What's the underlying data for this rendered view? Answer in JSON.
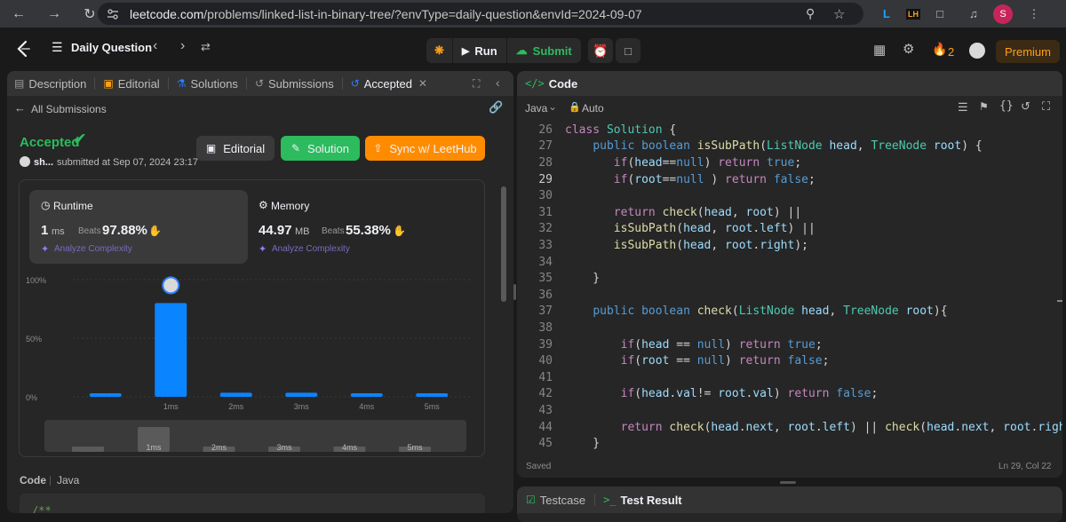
{
  "browser": {
    "url_host": "leetcode.com",
    "url_path": "/problems/linked-list-in-binary-tree/?envType=daily-question&envId=2024-09-07",
    "profile_initial": "S",
    "ext_lh": "LH"
  },
  "header": {
    "problem_list_title": "Daily Question",
    "run_label": "Run",
    "submit_label": "Submit",
    "streak_count": "2",
    "premium_label": "Premium"
  },
  "left_tabs": [
    {
      "label": "Description"
    },
    {
      "label": "Editorial"
    },
    {
      "label": "Solutions"
    },
    {
      "label": "Submissions"
    },
    {
      "label": "Accepted"
    }
  ],
  "submission": {
    "back_label": "All Submissions",
    "status": "Accepted",
    "user": "sh...",
    "submitted_text": "submitted at Sep 07, 2024 23:17",
    "editorial_btn": "Editorial",
    "solution_btn": "Solution",
    "sync_btn": "Sync w/ LeetHub"
  },
  "runtime": {
    "title": "Runtime",
    "value": "1",
    "unit": "ms",
    "beats_label": "Beats",
    "beats": "97.88%",
    "analyze": "Analyze Complexity"
  },
  "memory": {
    "title": "Memory",
    "value": "44.97",
    "unit": "MB",
    "beats_label": "Beats",
    "beats": "55.38%",
    "analyze": "Analyze Complexity"
  },
  "chart_data": {
    "type": "bar",
    "y_tick_labels": [
      "100%",
      "50%",
      "0%"
    ],
    "categories": [
      "",
      "1ms",
      "2ms",
      "3ms",
      "4ms",
      "5ms"
    ],
    "values": [
      3,
      80,
      3.5,
      3.5,
      3,
      3
    ],
    "ylim": [
      0,
      100
    ],
    "highlight_index": 1,
    "bar_color": "#0a84ff",
    "mini_ticks": [
      "1ms",
      "2ms",
      "3ms",
      "4ms",
      "5ms"
    ]
  },
  "bottom_code_header": {
    "code": "Code",
    "lang": "Java",
    "snippet": "/**"
  },
  "editor": {
    "title": "Code",
    "language": "Java",
    "mode": "Auto",
    "status_saved": "Saved",
    "cursor_pos": "Ln 29, Col 22"
  },
  "code_lines": [
    {
      "n": "26",
      "text": "class Solution {"
    },
    {
      "n": "27",
      "text": "    public boolean isSubPath(ListNode head, TreeNode root) {"
    },
    {
      "n": "28",
      "text": "       if(head==null) return true;"
    },
    {
      "n": "29",
      "text": "       if(root==null ) return false;"
    },
    {
      "n": "30",
      "text": ""
    },
    {
      "n": "31",
      "text": "       return check(head, root) ||"
    },
    {
      "n": "32",
      "text": "       isSubPath(head, root.left) ||"
    },
    {
      "n": "33",
      "text": "       isSubPath(head, root.right);"
    },
    {
      "n": "34",
      "text": ""
    },
    {
      "n": "35",
      "text": "    }"
    },
    {
      "n": "36",
      "text": ""
    },
    {
      "n": "37",
      "text": "    public boolean check(ListNode head, TreeNode root){"
    },
    {
      "n": "38",
      "text": ""
    },
    {
      "n": "39",
      "text": "        if(head == null) return true;"
    },
    {
      "n": "40",
      "text": "        if(root == null) return false;"
    },
    {
      "n": "41",
      "text": ""
    },
    {
      "n": "42",
      "text": "        if(head.val!= root.val) return false;"
    },
    {
      "n": "43",
      "text": ""
    },
    {
      "n": "44",
      "text": "        return check(head.next, root.left) || check(head.next, root.right);"
    },
    {
      "n": "45",
      "text": "    }"
    }
  ],
  "bottom_tabs": {
    "testcase": "Testcase",
    "result": "Test Result"
  }
}
